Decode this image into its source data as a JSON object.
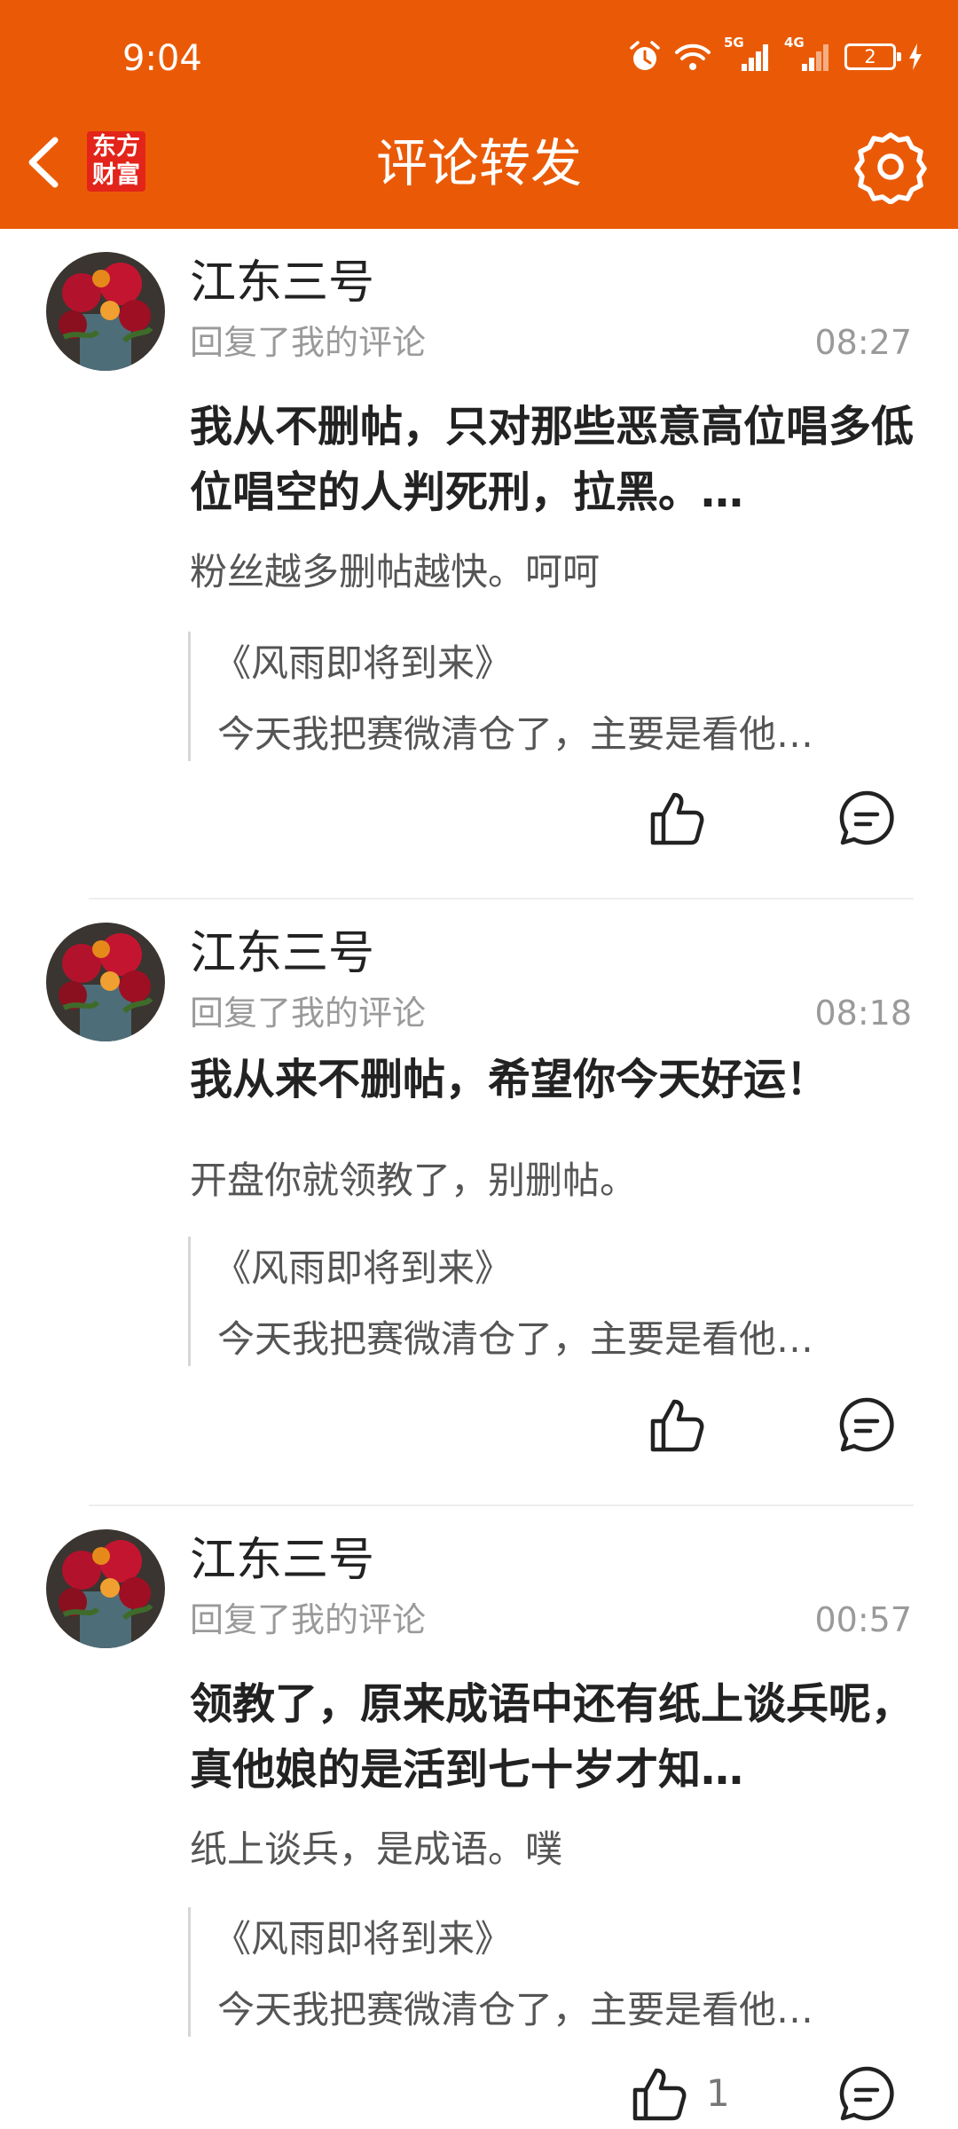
{
  "status_bar": {
    "time": "9:04",
    "network_5g": "5G",
    "network_4g": "4G",
    "battery": "2"
  },
  "header": {
    "title": "评论转发",
    "logo_line1": "东方",
    "logo_line2": "财富"
  },
  "items": [
    {
      "username": "江东三号",
      "action": "回复了我的评论",
      "time": "08:27",
      "reply": "我从不删帖，只对那些恶意高位唱多低位唱空的人判死刑，拉黑。…",
      "original_comment": "粉丝越多删帖越快。呵呵",
      "quote_title": "《风雨即将到来》",
      "quote_body": "今天我把赛微清仓了，主要是看他…",
      "likes": ""
    },
    {
      "username": "江东三号",
      "action": "回复了我的评论",
      "time": "08:18",
      "reply": "我从来不删帖，希望你今天好运！",
      "original_comment": "开盘你就领教了，别删帖。",
      "quote_title": "《风雨即将到来》",
      "quote_body": "今天我把赛微清仓了，主要是看他…",
      "likes": ""
    },
    {
      "username": "江东三号",
      "action": "回复了我的评论",
      "time": "00:57",
      "reply": "领教了，原来成语中还有纸上谈兵呢，真他娘的是活到七十岁才知…",
      "original_comment": "纸上谈兵，是成语。噗",
      "quote_title": "《风雨即将到来》",
      "quote_body": "今天我把赛微清仓了，主要是看他…",
      "likes": "1"
    }
  ]
}
